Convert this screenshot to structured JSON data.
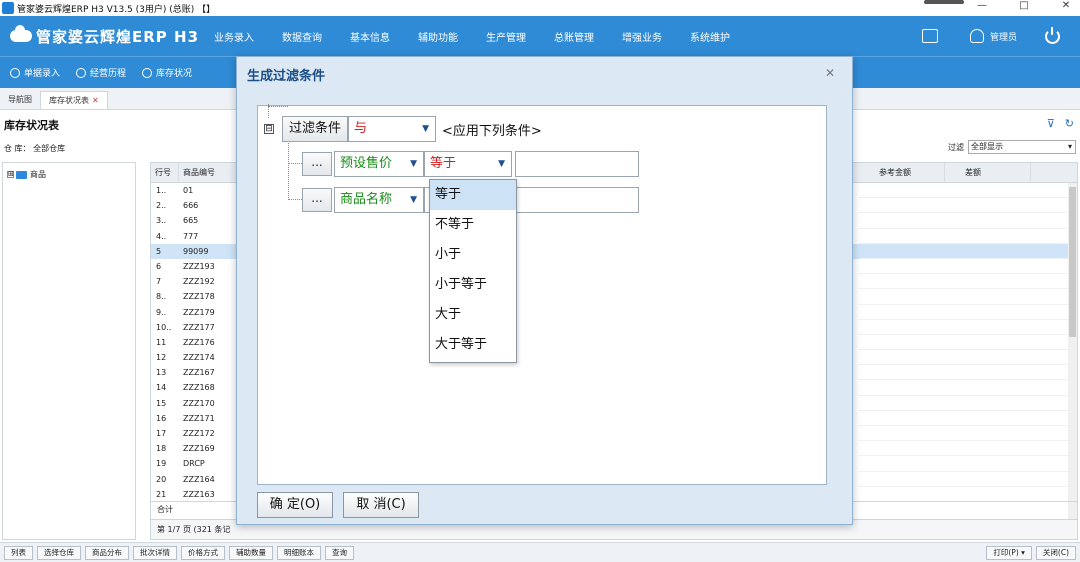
{
  "window": {
    "title": "管家婆云辉煌ERP H3 V13.5  (3用户)   (总账)  【】",
    "controls": [
      "—",
      "□",
      "✕"
    ]
  },
  "nav": {
    "logo": "管家婆云辉煌ERP H3",
    "menu": [
      "业务录入",
      "数据查询",
      "基本信息",
      "辅助功能",
      "生产管理",
      "总账管理",
      "增强业务",
      "系统维护"
    ],
    "user": "管理员"
  },
  "toolbar2": [
    "单据录入",
    "经营历程",
    "库存状况"
  ],
  "tabs": [
    {
      "label": "导航图"
    },
    {
      "label": "库存状况表",
      "close": "✕"
    }
  ],
  "page": {
    "title": "库存状况表",
    "warehouse_label": "仓  库：  全部仓库",
    "filter_label": "过滤",
    "filter_value": "全部显示"
  },
  "tree": {
    "expander": "⊞",
    "root_label": "商品"
  },
  "grid": {
    "col_row": "行号",
    "col_code": "商品编号",
    "right_cols": [
      "参考金额",
      "差额"
    ],
    "rows": [
      {
        "no": "1..",
        "code": "01"
      },
      {
        "no": "2..",
        "code": "666"
      },
      {
        "no": "3..",
        "code": "665"
      },
      {
        "no": "4..",
        "code": "777"
      },
      {
        "no": "5",
        "code": "99099"
      },
      {
        "no": "6",
        "code": "ZZZ193"
      },
      {
        "no": "7",
        "code": "ZZZ192"
      },
      {
        "no": "8..",
        "code": "ZZZ178"
      },
      {
        "no": "9..",
        "code": "ZZZ179"
      },
      {
        "no": "10..",
        "code": "ZZZ177"
      },
      {
        "no": "11",
        "code": "ZZZ176"
      },
      {
        "no": "12",
        "code": "ZZZ174"
      },
      {
        "no": "13",
        "code": "ZZZ167"
      },
      {
        "no": "14",
        "code": "ZZZ168"
      },
      {
        "no": "15",
        "code": "ZZZ170"
      },
      {
        "no": "16",
        "code": "ZZZ171"
      },
      {
        "no": "17",
        "code": "ZZZ172"
      },
      {
        "no": "18",
        "code": "ZZZ169"
      },
      {
        "no": "19",
        "code": "DRCP"
      },
      {
        "no": "20",
        "code": "ZZZ164"
      },
      {
        "no": "21",
        "code": "ZZZ163"
      }
    ],
    "total_label": "合计",
    "pager": "第 1/7 页 (321 条记"
  },
  "bottom": {
    "buttons": [
      "列表",
      "选择仓库",
      "商品分布",
      "批次详情",
      "价格方式",
      "辅助数量",
      "明细账本",
      "查询"
    ],
    "right_buttons": [
      "打印(P) ▾",
      "关闭(C)"
    ]
  },
  "modal": {
    "title": "生成过滤条件",
    "close": "✕",
    "root": {
      "expander": "⊟",
      "label": "过滤条件",
      "logic": "与",
      "apply_text": "<应用下列条件>"
    },
    "conditions": [
      {
        "dots": "...",
        "field": "预设售价",
        "op": "等于",
        "value": ""
      },
      {
        "dots": "...",
        "field": "商品名称",
        "op": "",
        "value": ""
      }
    ],
    "dropdown": [
      "等于",
      "不等于",
      "小于",
      "小于等于",
      "大于",
      "大于等于"
    ],
    "dropdown_selected": 0,
    "ok": "确 定(O)",
    "cancel": "取 消(C)"
  },
  "colors": {
    "nav_blue": "#2f8bd6",
    "dialog_bg": "#dce9f5",
    "logic_red": "#d21e1e",
    "field_green": "#1a8a1a",
    "selected_row": "#cfe5f7"
  }
}
